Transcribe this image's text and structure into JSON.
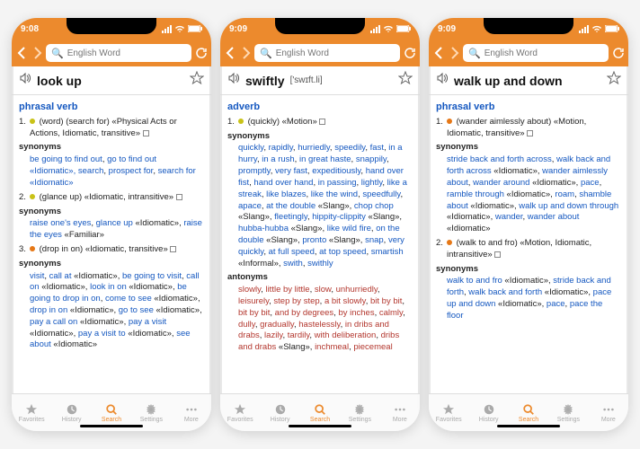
{
  "tabs": [
    "Favorites",
    "History",
    "Search",
    "Settings",
    "More"
  ],
  "search_placeholder": "English Word",
  "screens": [
    {
      "time": "9:08",
      "headword": "look up",
      "pron": "",
      "pos": "phrasal verb",
      "senses": [
        {
          "n": "1.",
          "dot": "yel",
          "def": "(word) (search for) «Physical Acts or Actions, Idiomatic, transitive»",
          "syn_label": "synonyms",
          "syns": [
            [
              "be going to find out",
              ", "
            ],
            [
              "go to find out",
              ""
            ],
            [
              " «Idiomatic», ",
              ""
            ],
            [
              "search",
              ", "
            ],
            [
              "prospect for",
              ", "
            ],
            [
              "search for",
              ""
            ],
            [
              " «Idiomatic»",
              ""
            ]
          ]
        },
        {
          "n": "2.",
          "dot": "yel",
          "def": "(glance up) «Idiomatic, intransitive»",
          "syn_label": "synonyms",
          "syns": [
            [
              "raise one's eyes",
              ", "
            ],
            [
              "glance up",
              " «Idiomatic», "
            ],
            [
              "raise the eyes",
              " «Familiar»"
            ]
          ]
        },
        {
          "n": "3.",
          "dot": "ora",
          "def": "(drop in on) «Idiomatic, transitive»",
          "syn_label": "synonyms",
          "syns": [
            [
              "visit",
              ", "
            ],
            [
              "call at",
              " «Idiomatic», "
            ],
            [
              "be going to visit",
              ", "
            ],
            [
              "call on",
              " «Idiomatic», "
            ],
            [
              "look in on",
              " «Idiomatic», "
            ],
            [
              "be going to drop in on",
              ", "
            ],
            [
              "come to see",
              " «Idiomatic», "
            ],
            [
              "drop in on",
              " «Idiomatic», "
            ],
            [
              "go to see",
              " «Idiomatic», "
            ],
            [
              "pay a call on",
              " «Idiomatic», "
            ],
            [
              "pay a visit",
              " «Idiomatic», "
            ],
            [
              "pay a visit to",
              " «Idiomatic», "
            ],
            [
              "see about",
              " «Idiomatic»"
            ]
          ]
        }
      ]
    },
    {
      "time": "9:09",
      "headword": "swiftly",
      "pron": "['swɪft.li]",
      "pos": "adverb",
      "senses": [
        {
          "n": "1.",
          "dot": "yel",
          "def": "(quickly) «Motion»",
          "syn_label": "synonyms",
          "syns": [
            [
              "quickly",
              ", "
            ],
            [
              "rapidly",
              ", "
            ],
            [
              "hurriedly",
              ", "
            ],
            [
              "speedily",
              ", "
            ],
            [
              "fast",
              ", "
            ],
            [
              "in a hurry",
              ", "
            ],
            [
              "in a rush",
              ", "
            ],
            [
              "in great haste",
              ", "
            ],
            [
              "snappily",
              ", "
            ],
            [
              "promptly",
              ", "
            ],
            [
              "very fast",
              ", "
            ],
            [
              "expeditiously",
              ", "
            ],
            [
              "hand over fist",
              ", "
            ],
            [
              "hand over hand",
              ", "
            ],
            [
              "in passing",
              ", "
            ],
            [
              "lightly",
              ", "
            ],
            [
              "like a streak",
              ", "
            ],
            [
              "like blazes",
              ", "
            ],
            [
              "like the wind",
              ", "
            ],
            [
              "speedfully",
              ", "
            ],
            [
              "apace",
              ", "
            ],
            [
              "at the double",
              " «Slang», "
            ],
            [
              "chop chop",
              " «Slang», "
            ],
            [
              "fleetingly",
              ", "
            ],
            [
              "hippity-clippity",
              " «Slang», "
            ],
            [
              "hubba-hubba",
              " «Slang», "
            ],
            [
              "like wild fire",
              ", "
            ],
            [
              "on the double",
              " «Slang», "
            ],
            [
              "pronto",
              " «Slang», "
            ],
            [
              "snap",
              ", "
            ],
            [
              "very quickly",
              ", "
            ],
            [
              "at full speed",
              ", "
            ],
            [
              "at top speed",
              ", "
            ],
            [
              "smartish",
              " «Informal», "
            ],
            [
              "swith",
              ", "
            ],
            [
              "swithly",
              ""
            ]
          ],
          "ant_label": "antonyms",
          "ants": [
            [
              "slowly",
              ", "
            ],
            [
              "little by little",
              ", "
            ],
            [
              "slow",
              ", "
            ],
            [
              "unhurriedly",
              ", "
            ],
            [
              "leisurely",
              ", "
            ],
            [
              "step by step",
              ", "
            ],
            [
              "a bit slowly",
              ", "
            ],
            [
              "bit by bit",
              ", "
            ],
            [
              "bit by bit",
              ", "
            ],
            [
              "and by degrees",
              ", "
            ],
            [
              "by inches",
              ", "
            ],
            [
              "calmly",
              ", "
            ],
            [
              "dully",
              ", "
            ],
            [
              "gradually",
              ", "
            ],
            [
              "hastelessly",
              ", "
            ],
            [
              "in dribs and drabs",
              ", "
            ],
            [
              "lazily",
              ", "
            ],
            [
              "tardily",
              ", "
            ],
            [
              "with deliberation",
              ", "
            ],
            [
              "dribs and drabs",
              " «Slang», "
            ],
            [
              "inchmeal",
              ", "
            ],
            [
              "piecemeal",
              ""
            ]
          ]
        }
      ]
    },
    {
      "time": "9:09",
      "headword": "walk up and down",
      "pron": "",
      "pos": "phrasal verb",
      "senses": [
        {
          "n": "1.",
          "dot": "ora",
          "def": "(wander aimlessly about) «Motion, Idiomatic, transitive»",
          "syn_label": "synonyms",
          "syns": [
            [
              "stride back and forth across",
              ", "
            ],
            [
              "walk back and forth across",
              " «Idiomatic», "
            ],
            [
              "wander aimlessly about",
              ", "
            ],
            [
              "wander around",
              " «Idiomatic», "
            ],
            [
              "pace",
              ", "
            ],
            [
              "ramble through",
              " «Idiomatic», "
            ],
            [
              "roam",
              ", "
            ],
            [
              "shamble about",
              " «Idiomatic», "
            ],
            [
              "walk up and down through",
              " «Idiomatic», "
            ],
            [
              "wander",
              ", "
            ],
            [
              "wander about",
              " «Idiomatic»"
            ]
          ]
        },
        {
          "n": "2.",
          "dot": "ora",
          "def": "(walk to and fro) «Motion, Idiomatic, intransitive»",
          "syn_label": "synonyms",
          "syns": [
            [
              "walk to and fro",
              " «Idiomatic», "
            ],
            [
              "stride back and forth",
              ", "
            ],
            [
              "walk back and forth",
              " «Idiomatic», "
            ],
            [
              "pace up and down",
              " «Idiomatic», "
            ],
            [
              "pace",
              ", "
            ],
            [
              "pace the floor",
              ""
            ]
          ]
        }
      ]
    }
  ]
}
